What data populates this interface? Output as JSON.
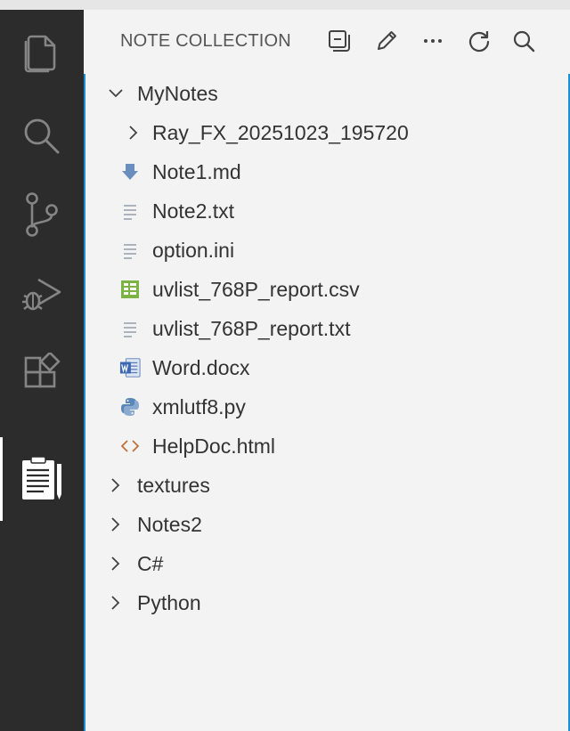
{
  "activity_bar": {
    "items": [
      {
        "icon": "files-icon"
      },
      {
        "icon": "search-icon"
      },
      {
        "icon": "source-control-icon"
      },
      {
        "icon": "run-debug-icon"
      },
      {
        "icon": "extensions-icon"
      },
      {
        "icon": "notepad-icon",
        "active": true
      }
    ]
  },
  "panel": {
    "title": "NOTE COLLECTION",
    "actions": [
      "collapse-all-icon",
      "edit-icon",
      "more-icon",
      "refresh-icon",
      "search-icon"
    ]
  },
  "tree": {
    "root": {
      "label": "MyNotes",
      "expanded": true
    },
    "children": [
      {
        "label": "Ray_FX_20251023_195720",
        "type": "folder",
        "icon": "chevron-right-icon"
      },
      {
        "label": "Note1.md",
        "type": "markdown",
        "icon": "markdown-icon"
      },
      {
        "label": "Note2.txt",
        "type": "text",
        "icon": "text-file-icon"
      },
      {
        "label": "option.ini",
        "type": "text",
        "icon": "text-file-icon"
      },
      {
        "label": "uvlist_768P_report.csv",
        "type": "csv",
        "icon": "csv-icon"
      },
      {
        "label": "uvlist_768P_report.txt",
        "type": "text",
        "icon": "text-file-icon"
      },
      {
        "label": "Word.docx",
        "type": "word",
        "icon": "word-icon"
      },
      {
        "label": "xmlutf8.py",
        "type": "python",
        "icon": "python-icon"
      },
      {
        "label": "HelpDoc.html",
        "type": "html",
        "icon": "html-icon"
      }
    ],
    "folders": [
      {
        "label": "textures"
      },
      {
        "label": "Notes2"
      },
      {
        "label": "C#"
      },
      {
        "label": "Python"
      }
    ]
  },
  "colors": {
    "activity_bar_bg": "#2c2c2c",
    "panel_bg": "#f3f3f3",
    "focus_border": "#1e90d6",
    "icon_gray": "#858585"
  }
}
